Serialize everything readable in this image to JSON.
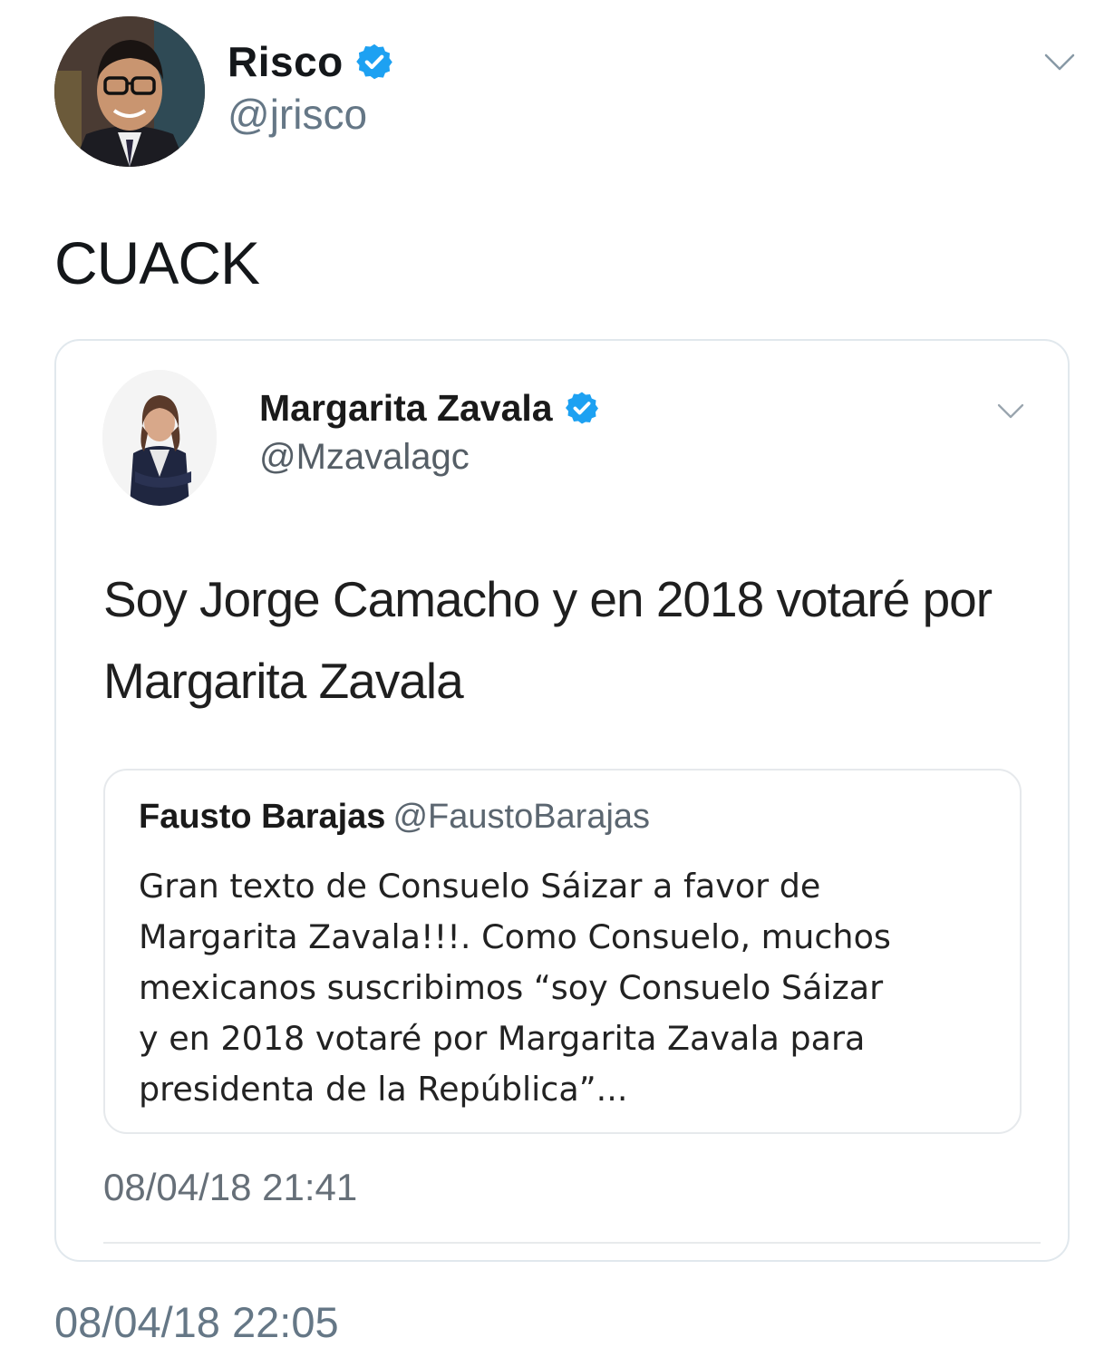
{
  "tweet": {
    "author_name": "Risco",
    "author_handle": "@jrisco",
    "text": "CUACK",
    "timestamp": "08/04/18 22:05",
    "verified_icon": "verified-badge-icon",
    "menu_icon": "chevron-down-icon"
  },
  "quoted_tweet": {
    "author_name": "Margarita Zavala",
    "author_handle": "@Mzavalagc",
    "text": "Soy Jorge Camacho y en 2018 votaré por Margarita Zavala",
    "timestamp": "08/04/18 21:41",
    "verified_icon": "verified-badge-icon",
    "menu_icon": "chevron-down-icon"
  },
  "inner_quote": {
    "author_name": "Fausto Barajas",
    "author_handle": "@FaustoBarajas",
    "text": "Gran texto de Consuelo Sáizar a favor de\nMargarita Zavala!!!.  Como Consuelo, muchos\nmexicanos suscribimos “soy Consuelo Sáizar\ny en 2018 votaré por Margarita Zavala para\npresidenta de la República”..."
  },
  "colors": {
    "verified_blue": "#1da1f2",
    "secondary_text": "#657786",
    "border": "#e1e8ed"
  }
}
